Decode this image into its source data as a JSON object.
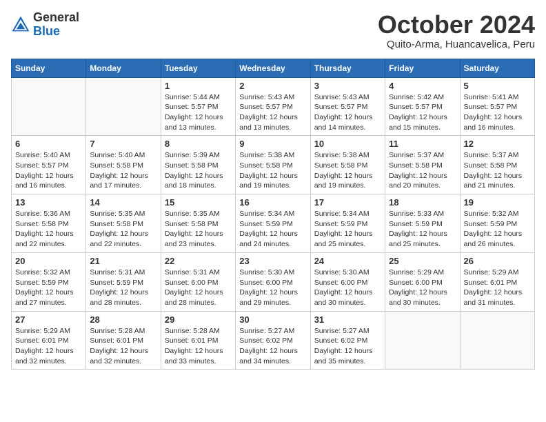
{
  "header": {
    "logo_general": "General",
    "logo_blue": "Blue",
    "month_title": "October 2024",
    "location": "Quito-Arma, Huancavelica, Peru"
  },
  "days_of_week": [
    "Sunday",
    "Monday",
    "Tuesday",
    "Wednesday",
    "Thursday",
    "Friday",
    "Saturday"
  ],
  "weeks": [
    [
      {
        "day": "",
        "sunrise": "",
        "sunset": "",
        "daylight": ""
      },
      {
        "day": "",
        "sunrise": "",
        "sunset": "",
        "daylight": ""
      },
      {
        "day": "1",
        "sunrise": "Sunrise: 5:44 AM",
        "sunset": "Sunset: 5:57 PM",
        "daylight": "Daylight: 12 hours and 13 minutes."
      },
      {
        "day": "2",
        "sunrise": "Sunrise: 5:43 AM",
        "sunset": "Sunset: 5:57 PM",
        "daylight": "Daylight: 12 hours and 13 minutes."
      },
      {
        "day": "3",
        "sunrise": "Sunrise: 5:43 AM",
        "sunset": "Sunset: 5:57 PM",
        "daylight": "Daylight: 12 hours and 14 minutes."
      },
      {
        "day": "4",
        "sunrise": "Sunrise: 5:42 AM",
        "sunset": "Sunset: 5:57 PM",
        "daylight": "Daylight: 12 hours and 15 minutes."
      },
      {
        "day": "5",
        "sunrise": "Sunrise: 5:41 AM",
        "sunset": "Sunset: 5:57 PM",
        "daylight": "Daylight: 12 hours and 16 minutes."
      }
    ],
    [
      {
        "day": "6",
        "sunrise": "Sunrise: 5:40 AM",
        "sunset": "Sunset: 5:57 PM",
        "daylight": "Daylight: 12 hours and 16 minutes."
      },
      {
        "day": "7",
        "sunrise": "Sunrise: 5:40 AM",
        "sunset": "Sunset: 5:58 PM",
        "daylight": "Daylight: 12 hours and 17 minutes."
      },
      {
        "day": "8",
        "sunrise": "Sunrise: 5:39 AM",
        "sunset": "Sunset: 5:58 PM",
        "daylight": "Daylight: 12 hours and 18 minutes."
      },
      {
        "day": "9",
        "sunrise": "Sunrise: 5:38 AM",
        "sunset": "Sunset: 5:58 PM",
        "daylight": "Daylight: 12 hours and 19 minutes."
      },
      {
        "day": "10",
        "sunrise": "Sunrise: 5:38 AM",
        "sunset": "Sunset: 5:58 PM",
        "daylight": "Daylight: 12 hours and 19 minutes."
      },
      {
        "day": "11",
        "sunrise": "Sunrise: 5:37 AM",
        "sunset": "Sunset: 5:58 PM",
        "daylight": "Daylight: 12 hours and 20 minutes."
      },
      {
        "day": "12",
        "sunrise": "Sunrise: 5:37 AM",
        "sunset": "Sunset: 5:58 PM",
        "daylight": "Daylight: 12 hours and 21 minutes."
      }
    ],
    [
      {
        "day": "13",
        "sunrise": "Sunrise: 5:36 AM",
        "sunset": "Sunset: 5:58 PM",
        "daylight": "Daylight: 12 hours and 22 minutes."
      },
      {
        "day": "14",
        "sunrise": "Sunrise: 5:35 AM",
        "sunset": "Sunset: 5:58 PM",
        "daylight": "Daylight: 12 hours and 22 minutes."
      },
      {
        "day": "15",
        "sunrise": "Sunrise: 5:35 AM",
        "sunset": "Sunset: 5:58 PM",
        "daylight": "Daylight: 12 hours and 23 minutes."
      },
      {
        "day": "16",
        "sunrise": "Sunrise: 5:34 AM",
        "sunset": "Sunset: 5:59 PM",
        "daylight": "Daylight: 12 hours and 24 minutes."
      },
      {
        "day": "17",
        "sunrise": "Sunrise: 5:34 AM",
        "sunset": "Sunset: 5:59 PM",
        "daylight": "Daylight: 12 hours and 25 minutes."
      },
      {
        "day": "18",
        "sunrise": "Sunrise: 5:33 AM",
        "sunset": "Sunset: 5:59 PM",
        "daylight": "Daylight: 12 hours and 25 minutes."
      },
      {
        "day": "19",
        "sunrise": "Sunrise: 5:32 AM",
        "sunset": "Sunset: 5:59 PM",
        "daylight": "Daylight: 12 hours and 26 minutes."
      }
    ],
    [
      {
        "day": "20",
        "sunrise": "Sunrise: 5:32 AM",
        "sunset": "Sunset: 5:59 PM",
        "daylight": "Daylight: 12 hours and 27 minutes."
      },
      {
        "day": "21",
        "sunrise": "Sunrise: 5:31 AM",
        "sunset": "Sunset: 5:59 PM",
        "daylight": "Daylight: 12 hours and 28 minutes."
      },
      {
        "day": "22",
        "sunrise": "Sunrise: 5:31 AM",
        "sunset": "Sunset: 6:00 PM",
        "daylight": "Daylight: 12 hours and 28 minutes."
      },
      {
        "day": "23",
        "sunrise": "Sunrise: 5:30 AM",
        "sunset": "Sunset: 6:00 PM",
        "daylight": "Daylight: 12 hours and 29 minutes."
      },
      {
        "day": "24",
        "sunrise": "Sunrise: 5:30 AM",
        "sunset": "Sunset: 6:00 PM",
        "daylight": "Daylight: 12 hours and 30 minutes."
      },
      {
        "day": "25",
        "sunrise": "Sunrise: 5:29 AM",
        "sunset": "Sunset: 6:00 PM",
        "daylight": "Daylight: 12 hours and 30 minutes."
      },
      {
        "day": "26",
        "sunrise": "Sunrise: 5:29 AM",
        "sunset": "Sunset: 6:01 PM",
        "daylight": "Daylight: 12 hours and 31 minutes."
      }
    ],
    [
      {
        "day": "27",
        "sunrise": "Sunrise: 5:29 AM",
        "sunset": "Sunset: 6:01 PM",
        "daylight": "Daylight: 12 hours and 32 minutes."
      },
      {
        "day": "28",
        "sunrise": "Sunrise: 5:28 AM",
        "sunset": "Sunset: 6:01 PM",
        "daylight": "Daylight: 12 hours and 32 minutes."
      },
      {
        "day": "29",
        "sunrise": "Sunrise: 5:28 AM",
        "sunset": "Sunset: 6:01 PM",
        "daylight": "Daylight: 12 hours and 33 minutes."
      },
      {
        "day": "30",
        "sunrise": "Sunrise: 5:27 AM",
        "sunset": "Sunset: 6:02 PM",
        "daylight": "Daylight: 12 hours and 34 minutes."
      },
      {
        "day": "31",
        "sunrise": "Sunrise: 5:27 AM",
        "sunset": "Sunset: 6:02 PM",
        "daylight": "Daylight: 12 hours and 35 minutes."
      },
      {
        "day": "",
        "sunrise": "",
        "sunset": "",
        "daylight": ""
      },
      {
        "day": "",
        "sunrise": "",
        "sunset": "",
        "daylight": ""
      }
    ]
  ]
}
